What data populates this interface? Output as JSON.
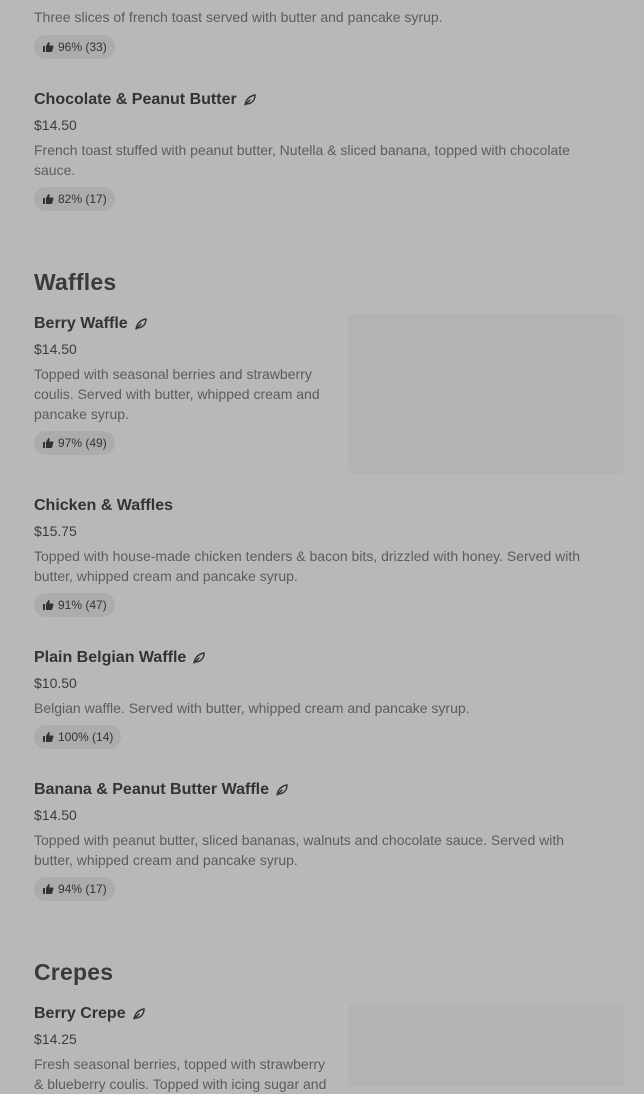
{
  "items": {
    "french_toast_top": {
      "description": "Three slices of french toast served with butter and pancake syrup.",
      "rating": "96% (33)"
    },
    "choc_pb": {
      "name": "Chocolate & Peanut Butter",
      "price": "$14.50",
      "description": "French toast stuffed with peanut butter, Nutella & sliced banana, topped with chocolate sauce.",
      "rating": "82% (17)"
    },
    "berry_waffle": {
      "name": "Berry Waffle",
      "price": "$14.50",
      "description": "Topped with seasonal berries and strawberry coulis. Served with butter, whipped cream and pancake syrup.",
      "rating": "97% (49)"
    },
    "chicken_waffles": {
      "name": "Chicken & Waffles",
      "price": "$15.75",
      "description": "Topped with house-made chicken tenders & bacon bits, drizzled with honey. Served with butter, whipped cream and pancake syrup.",
      "rating": "91% (47)"
    },
    "plain_belgian": {
      "name": "Plain Belgian Waffle",
      "price": "$10.50",
      "description": "Belgian waffle. Served with butter, whipped cream and pancake syrup.",
      "rating": "100% (14)"
    },
    "banana_pb_waffle": {
      "name": "Banana & Peanut Butter Waffle",
      "price": "$14.50",
      "description": "Topped with peanut butter, sliced bananas, walnuts and chocolate sauce. Served with butter, whipped cream and pancake syrup.",
      "rating": "94% (17)"
    },
    "berry_crepe": {
      "name": "Berry Crepe",
      "price": "$14.25",
      "description": "Fresh seasonal berries, topped with strawberry & blueberry coulis. Topped with icing sugar and"
    }
  },
  "sections": {
    "waffles": "Waffles",
    "crepes": "Crepes"
  },
  "icons": {
    "leaf": "leaf-icon",
    "thumb": "thumbs-up-icon"
  },
  "colors": {
    "background": "#b8b8b8",
    "badge": "#acacac",
    "image_placeholder": "#b3b3b3"
  }
}
